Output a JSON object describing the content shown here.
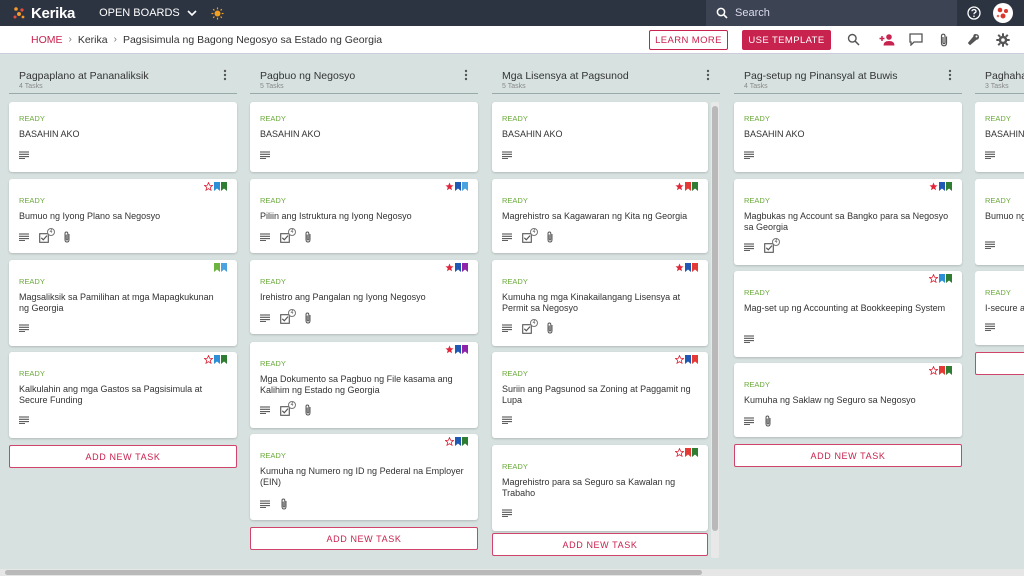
{
  "app": {
    "name": "Kerika",
    "open_boards": "OPEN BOARDS",
    "search_placeholder": "Search"
  },
  "breadcrumb": {
    "home": "HOME",
    "org": "Kerika",
    "board": "Pagsisimula ng Bagong Negosyo sa Estado ng Georgia"
  },
  "toolbar": {
    "learn_more": "LEARN MORE",
    "use_template": "USE TEMPLATE"
  },
  "colors": {
    "accent": "#c8224e",
    "topbar": "#2c3341",
    "board_bg": "#d7e2e0",
    "ready": "#6aaa3a"
  },
  "add_task_label": "ADD NEW TASK",
  "columns": [
    {
      "title": "Pagpaplano at Pananaliksik",
      "count": "4 Tasks",
      "cards": [
        {
          "status": "READY",
          "title": "BASAHIN AKO",
          "flags": [],
          "icons": [
            "description-icon"
          ]
        },
        {
          "status": "READY",
          "title": "Bumuo ng Iyong Plano sa Negosyo",
          "flags": [
            "star-outline",
            "blue",
            "green"
          ],
          "icons": [
            "description-icon",
            "checklist-icon",
            "attachment-icon"
          ],
          "checklist": "4"
        },
        {
          "status": "READY",
          "title": "Magsaliksik sa Pamilihan at mga Mapagkukunan ng Georgia",
          "flags": [
            "green-light",
            "blue-light"
          ],
          "icons": [
            "description-icon"
          ]
        },
        {
          "status": "READY",
          "title": "Kalkulahin ang mga Gastos sa Pagsisimula at Secure Funding",
          "flags": [
            "star-outline",
            "blue",
            "green"
          ],
          "icons": [
            "description-icon"
          ]
        }
      ]
    },
    {
      "title": "Pagbuo ng Negosyo",
      "count": "5 Tasks",
      "cards": [
        {
          "status": "READY",
          "title": "BASAHIN AKO",
          "flags": [],
          "icons": [
            "description-icon"
          ]
        },
        {
          "status": "READY",
          "title": "Piliin ang Istruktura ng Iyong Negosyo",
          "flags": [
            "star-filled",
            "blue-dark",
            "blue-light"
          ],
          "icons": [
            "description-icon",
            "checklist-icon",
            "attachment-icon"
          ],
          "checklist": "4"
        },
        {
          "status": "READY",
          "title": "Irehistro ang Pangalan ng Iyong Negosyo",
          "flags": [
            "star-filled",
            "blue-dark",
            "purple"
          ],
          "icons": [
            "description-icon",
            "checklist-icon",
            "attachment-icon"
          ],
          "checklist": "4"
        },
        {
          "status": "READY",
          "title": "Mga Dokumento sa Pagbuo ng File kasama ang Kalihim ng Estado ng Georgia",
          "flags": [
            "star-filled",
            "blue-dark",
            "purple"
          ],
          "icons": [
            "description-icon",
            "checklist-icon",
            "attachment-icon"
          ],
          "checklist": "4"
        },
        {
          "status": "READY",
          "title": "Kumuha ng Numero ng ID ng Pederal na Employer (EIN)",
          "flags": [
            "star-outline",
            "blue-dark",
            "green"
          ],
          "icons": [
            "description-icon",
            "attachment-icon"
          ]
        }
      ]
    },
    {
      "title": "Mga Lisensya at Pagsunod",
      "count": "5 Tasks",
      "cards": [
        {
          "status": "READY",
          "title": "BASAHIN AKO",
          "flags": [],
          "icons": [
            "description-icon"
          ]
        },
        {
          "status": "READY",
          "title": "Magrehistro sa Kagawaran ng Kita ng Georgia",
          "flags": [
            "star-filled",
            "red",
            "green"
          ],
          "icons": [
            "description-icon",
            "checklist-icon",
            "attachment-icon"
          ],
          "checklist": "4"
        },
        {
          "status": "READY",
          "title": "Kumuha ng mga Kinakailangang Lisensya at Permit sa Negosyo",
          "flags": [
            "star-filled",
            "blue-dark",
            "red"
          ],
          "icons": [
            "description-icon",
            "checklist-icon",
            "attachment-icon"
          ],
          "checklist": "4"
        },
        {
          "status": "READY",
          "title": "Suriin ang Pagsunod sa Zoning at Paggamit ng Lupa",
          "flags": [
            "star-outline",
            "blue-dark",
            "red"
          ],
          "icons": [
            "description-icon"
          ]
        },
        {
          "status": "READY",
          "title": "Magrehistro para sa Seguro sa Kawalan ng Trabaho",
          "flags": [
            "star-outline",
            "red",
            "green"
          ],
          "icons": [
            "description-icon"
          ]
        }
      ]
    },
    {
      "title": "Pag-setup ng Pinansyal at Buwis",
      "count": "4 Tasks",
      "cards": [
        {
          "status": "READY",
          "title": "BASAHIN AKO",
          "flags": [],
          "icons": [
            "description-icon"
          ]
        },
        {
          "status": "READY",
          "title": "Magbukas ng Account sa Bangko para sa Negosyo sa Georgia",
          "flags": [
            "star-filled",
            "blue-dark",
            "green"
          ],
          "icons": [
            "description-icon",
            "checklist-icon"
          ],
          "checklist": "4"
        },
        {
          "status": "READY",
          "title": "Mag-set up ng Accounting at Bookkeeping System",
          "flags": [
            "star-outline",
            "blue",
            "green"
          ],
          "icons": [
            "description-icon"
          ]
        },
        {
          "status": "READY",
          "title": "Kumuha ng Saklaw ng Seguro sa Negosyo",
          "flags": [
            "star-outline",
            "red",
            "green"
          ],
          "icons": [
            "description-icon",
            "attachment-icon"
          ]
        }
      ]
    },
    {
      "title": "Paghaha",
      "count": "3 Tasks",
      "cards": [
        {
          "status": "READY",
          "title": "BASAHIN",
          "flags": [],
          "icons": [
            "description-icon"
          ]
        },
        {
          "status": "READY",
          "title": "Bumuo ng",
          "flags": [],
          "icons": [
            "description-icon"
          ]
        },
        {
          "status": "READY",
          "title": "I-secure a",
          "flags": [],
          "icons": [
            "description-icon"
          ]
        }
      ]
    }
  ]
}
